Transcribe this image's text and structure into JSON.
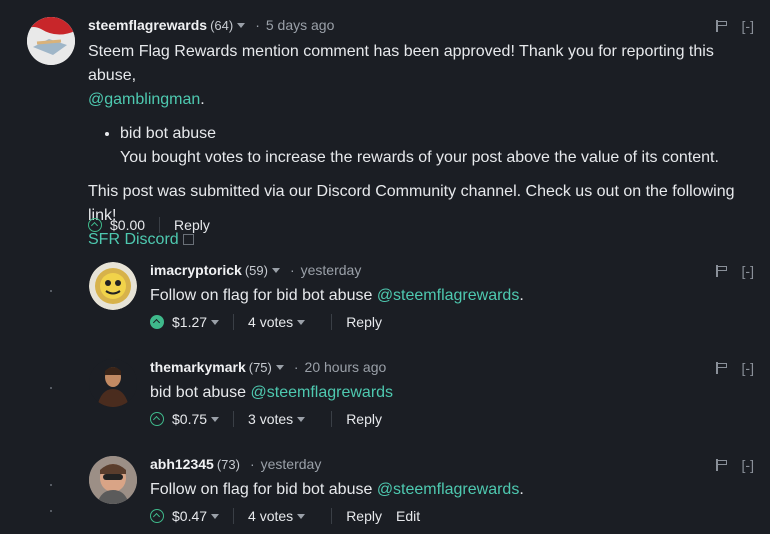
{
  "comments": [
    {
      "author": "steemflagrewards",
      "rep": "(64)",
      "time": "5 days ago",
      "collapse": "[-]",
      "text_intro": "Steem Flag Rewards mention comment has been approved! Thank you for reporting this abuse,",
      "mention": "@gamblingman",
      "bullet_title": "bid bot abuse",
      "bullet_desc": "You bought votes to increase the rewards of your post above the value of its content.",
      "discord_text": "This post was submitted via our Discord Community channel. Check us out on the following link!",
      "discord_link": "SFR Discord",
      "payout": "$0.00",
      "reply": "Reply"
    },
    {
      "author": "imacryptorick",
      "rep": "(59)",
      "time": "yesterday",
      "collapse": "[-]",
      "text": "Follow on flag for bid bot abuse",
      "mention": "@steemflagrewards",
      "suffix": ".",
      "payout": "$1.27",
      "votes": "4 votes",
      "reply": "Reply"
    },
    {
      "author": "themarkymark",
      "rep": "(75)",
      "time": "20 hours ago",
      "collapse": "[-]",
      "text": "bid bot abuse",
      "mention": "@steemflagrewards",
      "payout": "$0.75",
      "votes": "3 votes",
      "reply": "Reply"
    },
    {
      "author": "abh12345",
      "rep": "(73)",
      "time": "yesterday",
      "collapse": "[-]",
      "text": "Follow on flag for bid bot abuse",
      "mention": "@steemflagrewards",
      "suffix": ".",
      "payout": "$0.47",
      "votes": "4 votes",
      "reply": "Reply",
      "edit": "Edit"
    }
  ],
  "colors": {
    "background": "#1b1e24",
    "link": "#4ec9b0",
    "upvote": "#3fb98b"
  }
}
